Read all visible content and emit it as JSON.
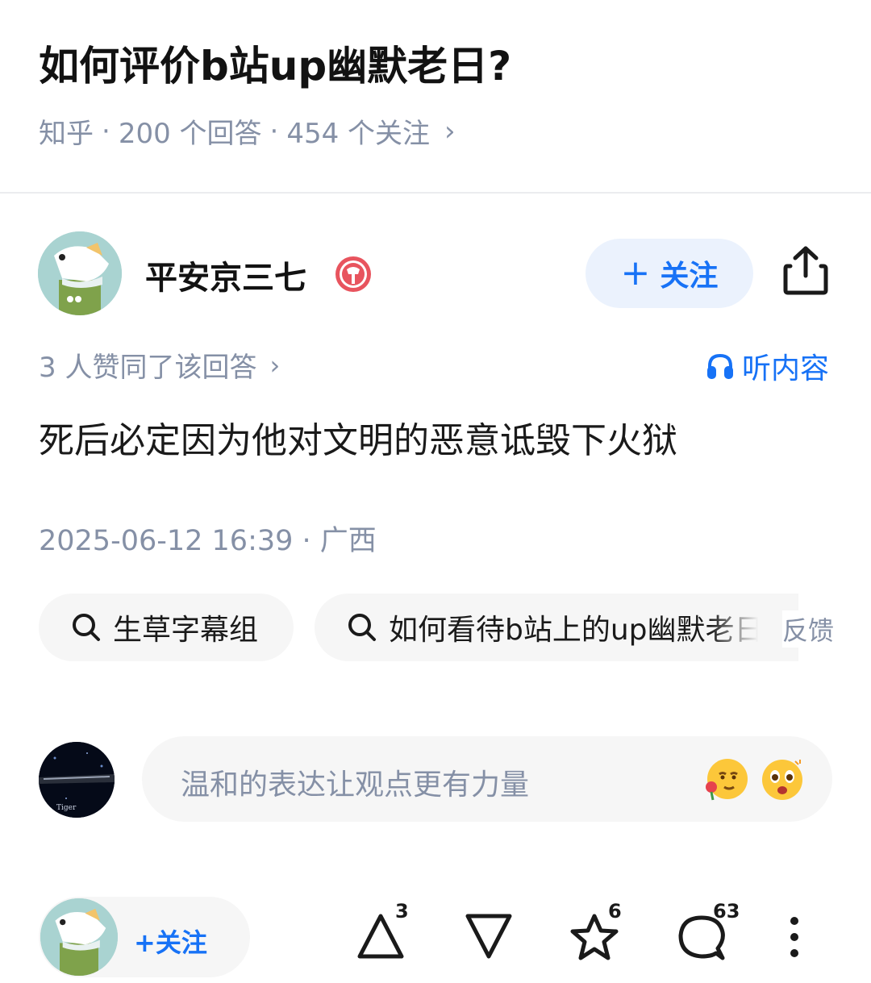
{
  "question": {
    "title": "如何评价b站up幽默老日?",
    "source": "知乎",
    "answers": "200 个回答",
    "follows": "454 个关注",
    "chevron": "›"
  },
  "author": {
    "name": "平安京三七",
    "follow_label": "关注",
    "follow_plus": "+"
  },
  "answer": {
    "votes_line": "3 人赞同了该回答",
    "votes_chevron": "›",
    "listen_label": "听内容",
    "text": "死后必定因为他对文明的恶意诋毁下火狱",
    "time": "2025-06-12 16:39 · 广西"
  },
  "tags": [
    {
      "label": "生草字幕组"
    },
    {
      "label": "如何看待b站上的up幽默老日"
    }
  ],
  "feedback_label": "反馈",
  "comment": {
    "placeholder": "温和的表达让观点更有力量",
    "avatar_text": "Tiger"
  },
  "bottom_bar": {
    "follow_label": "+关注",
    "upvote_count": "3",
    "favorite_count": "6",
    "comment_count": "63"
  },
  "colors": {
    "accent": "#1772f6",
    "muted": "#8590a6",
    "pill_bg": "#f6f6f6",
    "follow_bg": "#ebf2fd"
  },
  "icons": [
    "share-icon",
    "headphone-icon",
    "search-icon",
    "upvote-icon",
    "downvote-icon",
    "star-icon",
    "comment-icon",
    "more-icon"
  ]
}
